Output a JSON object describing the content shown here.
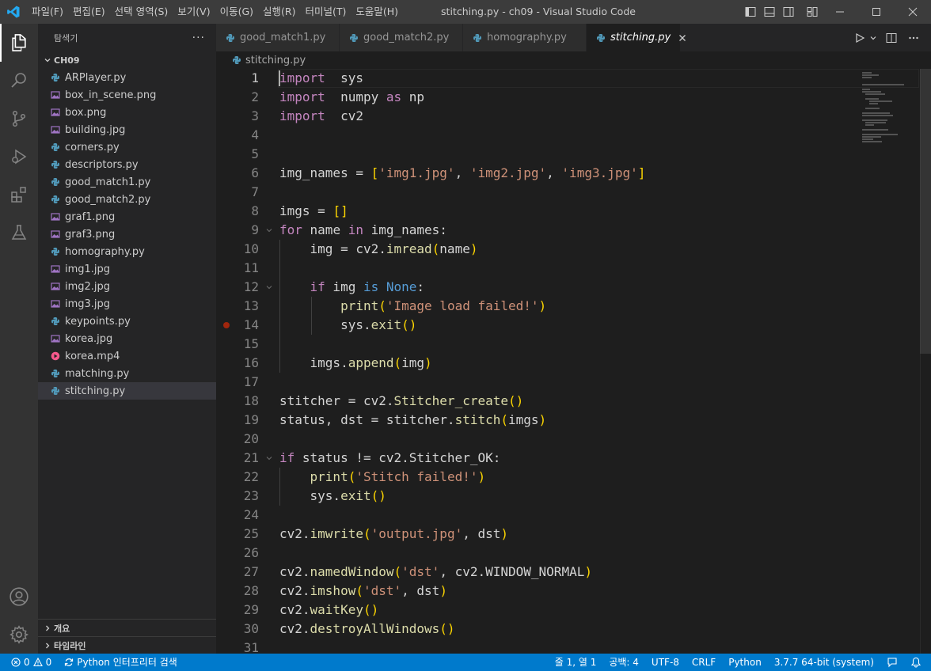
{
  "window": {
    "title": "stitching.py - ch09 - Visual Studio Code",
    "menu": [
      "파일(F)",
      "편집(E)",
      "선택 영역(S)",
      "보기(V)",
      "이동(G)",
      "실행(R)",
      "터미널(T)",
      "도움말(H)"
    ]
  },
  "colors": {
    "accent": "#007acc",
    "titlebar": "#3c3c3c",
    "sidebar": "#252526",
    "editor": "#1e1e1e",
    "python_icon": "#519aba",
    "image_icon": "#a074c4",
    "video_icon": "#f7598c"
  },
  "sidebar": {
    "header": "탐색기",
    "more": "···",
    "folder": "CH09",
    "files": [
      {
        "name": "ARPlayer.py",
        "icon": "python-icon"
      },
      {
        "name": "box_in_scene.png",
        "icon": "image-icon"
      },
      {
        "name": "box.png",
        "icon": "image-icon"
      },
      {
        "name": "building.jpg",
        "icon": "image-icon"
      },
      {
        "name": "corners.py",
        "icon": "python-icon"
      },
      {
        "name": "descriptors.py",
        "icon": "python-icon"
      },
      {
        "name": "good_match1.py",
        "icon": "python-icon"
      },
      {
        "name": "good_match2.py",
        "icon": "python-icon"
      },
      {
        "name": "graf1.png",
        "icon": "image-icon"
      },
      {
        "name": "graf3.png",
        "icon": "image-icon"
      },
      {
        "name": "homography.py",
        "icon": "python-icon"
      },
      {
        "name": "img1.jpg",
        "icon": "image-icon"
      },
      {
        "name": "img2.jpg",
        "icon": "image-icon"
      },
      {
        "name": "img3.jpg",
        "icon": "image-icon"
      },
      {
        "name": "keypoints.py",
        "icon": "python-icon"
      },
      {
        "name": "korea.jpg",
        "icon": "image-icon"
      },
      {
        "name": "korea.mp4",
        "icon": "video-icon"
      },
      {
        "name": "matching.py",
        "icon": "python-icon"
      },
      {
        "name": "stitching.py",
        "icon": "python-icon"
      }
    ],
    "sections": [
      "개요",
      "타임라인"
    ]
  },
  "tabs": [
    {
      "label": "good_match1.py",
      "active": false
    },
    {
      "label": "good_match2.py",
      "active": false
    },
    {
      "label": "homography.py",
      "active": false
    },
    {
      "label": "stitching.py",
      "active": true
    }
  ],
  "breadcrumb": "stitching.py",
  "editor": {
    "lines": [
      [
        [
          "kw",
          "import"
        ],
        [
          "",
          "  sys"
        ]
      ],
      [
        [
          "kw",
          "import"
        ],
        [
          "",
          "  numpy "
        ],
        [
          "kw",
          "as"
        ],
        [
          "",
          " np"
        ]
      ],
      [
        [
          "kw",
          "import"
        ],
        [
          "",
          "  cv2"
        ]
      ],
      [],
      [],
      [
        [
          "",
          "img_names = "
        ],
        [
          "br",
          "["
        ],
        [
          "str",
          "'img1.jpg'"
        ],
        [
          "",
          ", "
        ],
        [
          "str",
          "'img2.jpg'"
        ],
        [
          "",
          ", "
        ],
        [
          "str",
          "'img3.jpg'"
        ],
        [
          "br",
          "]"
        ]
      ],
      [],
      [
        [
          "",
          "imgs = "
        ],
        [
          "br",
          "[]"
        ]
      ],
      [
        [
          "kw",
          "for"
        ],
        [
          "",
          " name "
        ],
        [
          "kw",
          "in"
        ],
        [
          "",
          " img_names:"
        ]
      ],
      [
        [
          "",
          "    img = cv2."
        ],
        [
          "fn",
          "imread"
        ],
        [
          "br",
          "("
        ],
        [
          "",
          "name"
        ],
        [
          "br",
          ")"
        ]
      ],
      [],
      [
        [
          "",
          "    "
        ],
        [
          "kw",
          "if"
        ],
        [
          "",
          " img "
        ],
        [
          "bl",
          "is"
        ],
        [
          "",
          " "
        ],
        [
          "bl",
          "None"
        ],
        [
          "",
          ":"
        ]
      ],
      [
        [
          "",
          "        "
        ],
        [
          "fn",
          "print"
        ],
        [
          "br",
          "("
        ],
        [
          "str",
          "'Image load failed!'"
        ],
        [
          "br",
          ")"
        ]
      ],
      [
        [
          "",
          "        sys."
        ],
        [
          "fn",
          "exit"
        ],
        [
          "br",
          "()"
        ]
      ],
      [],
      [
        [
          "",
          "    imgs."
        ],
        [
          "fn",
          "append"
        ],
        [
          "br",
          "("
        ],
        [
          "",
          "img"
        ],
        [
          "br",
          ")"
        ]
      ],
      [],
      [
        [
          "",
          "stitcher = cv2."
        ],
        [
          "fn",
          "Stitcher_create"
        ],
        [
          "br",
          "()"
        ]
      ],
      [
        [
          "",
          "status, dst = stitcher."
        ],
        [
          "fn",
          "stitch"
        ],
        [
          "br",
          "("
        ],
        [
          "",
          "imgs"
        ],
        [
          "br",
          ")"
        ]
      ],
      [],
      [
        [
          "kw",
          "if"
        ],
        [
          "",
          " status != cv2.Stitcher_OK:"
        ]
      ],
      [
        [
          "",
          "    "
        ],
        [
          "fn",
          "print"
        ],
        [
          "br",
          "("
        ],
        [
          "str",
          "'Stitch failed!'"
        ],
        [
          "br",
          ")"
        ]
      ],
      [
        [
          "",
          "    sys."
        ],
        [
          "fn",
          "exit"
        ],
        [
          "br",
          "()"
        ]
      ],
      [],
      [
        [
          "",
          "cv2."
        ],
        [
          "fn",
          "imwrite"
        ],
        [
          "br",
          "("
        ],
        [
          "str",
          "'output.jpg'"
        ],
        [
          "",
          ", dst"
        ],
        [
          "br",
          ")"
        ]
      ],
      [],
      [
        [
          "",
          "cv2."
        ],
        [
          "fn",
          "namedWindow"
        ],
        [
          "br",
          "("
        ],
        [
          "str",
          "'dst'"
        ],
        [
          "",
          ", cv2.WINDOW_NORMAL"
        ],
        [
          "br",
          ")"
        ]
      ],
      [
        [
          "",
          "cv2."
        ],
        [
          "fn",
          "imshow"
        ],
        [
          "br",
          "("
        ],
        [
          "str",
          "'dst'"
        ],
        [
          "",
          ", dst"
        ],
        [
          "br",
          ")"
        ]
      ],
      [
        [
          "",
          "cv2."
        ],
        [
          "fn",
          "waitKey"
        ],
        [
          "br",
          "()"
        ]
      ],
      [
        [
          "",
          "cv2."
        ],
        [
          "fn",
          "destroyAllWindows"
        ],
        [
          "br",
          "()"
        ]
      ],
      []
    ],
    "breakpoint_line": 14,
    "fold_lines": [
      9,
      12,
      21
    ],
    "current_line": 1
  },
  "status": {
    "errors": "0",
    "warnings": "0",
    "interpreter": "Python 인터프리터 검색",
    "position": "줄 1, 열 1",
    "spaces": "공백: 4",
    "encoding": "UTF-8",
    "eol": "CRLF",
    "language": "Python",
    "python_version": "3.7.7 64-bit (system)"
  }
}
